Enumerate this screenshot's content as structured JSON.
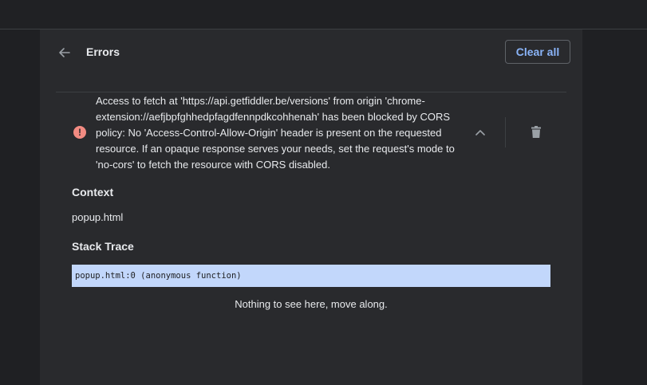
{
  "header": {
    "title": "Errors",
    "clear_all_label": "Clear all"
  },
  "error": {
    "message": "Access to fetch at 'https://api.getfiddler.be/versions' from origin 'chrome-extension://aefjbpfghhedpfagdfennpdkcohhenah' has been blocked by CORS policy: No 'Access-Control-Allow-Origin' header is present on the requested resource. If an opaque response serves your needs, set the request's mode to 'no-cors' to fetch the resource with CORS disabled."
  },
  "details": {
    "context_heading": "Context",
    "context_value": "popup.html",
    "stack_heading": "Stack Trace",
    "stack_line": "popup.html:0 (anonymous function)",
    "empty_message": "Nothing to see here, move along."
  },
  "icons": {
    "back": "arrow-back-icon",
    "error": "error-icon",
    "collapse": "chevron-up-icon",
    "delete": "trash-icon"
  },
  "colors": {
    "accent": "#8ab4f8",
    "error": "#f28b82",
    "stack_highlight": "#c2d7fb"
  }
}
